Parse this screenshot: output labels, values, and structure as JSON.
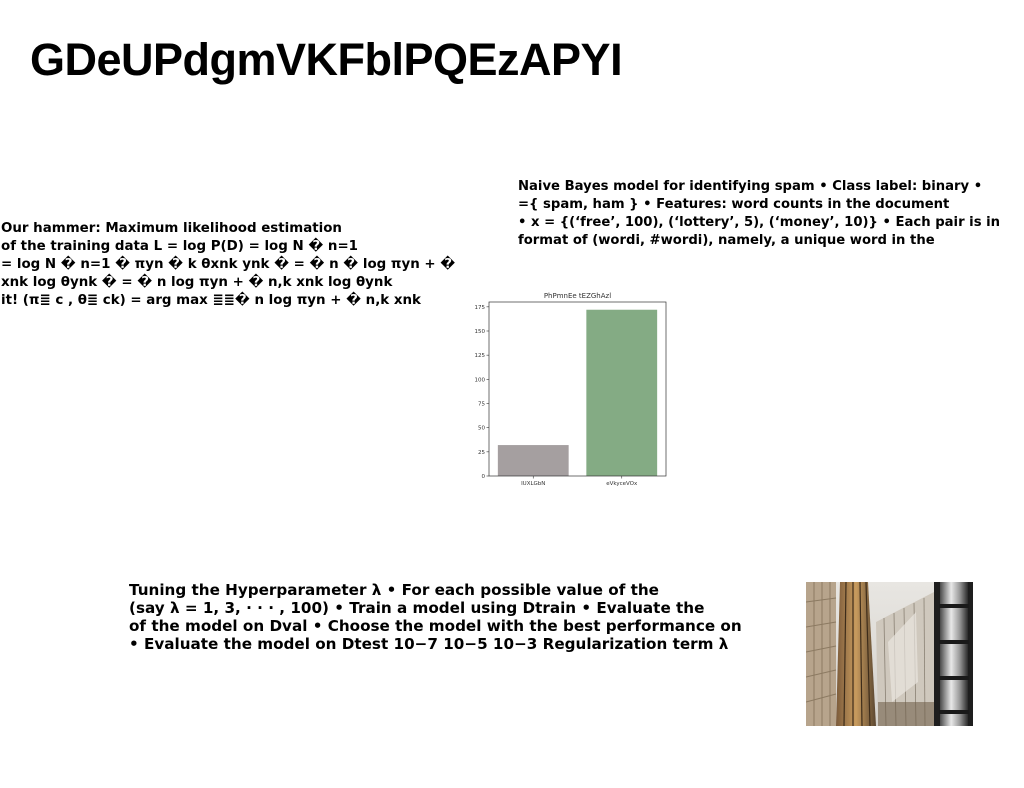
{
  "title": "GDeUPdgmVKFblPQEzAPYI",
  "spam_text": {
    "lines": [
      "Naive Bayes model for identifying spam • Class label: binary •",
      "={ spam, ham } • Features: word counts in the document",
      "• x = {(‘free’, 100), (‘lottery’, 5), (‘money’, 10)} • Each pair is in",
      "format of (wordi, #wordi), namely, a unique word in the"
    ]
  },
  "mle_text": {
    "lines": [
      "Our hammer: Maximum likelihood estimation",
      "of the training data L = log P(D) = log N � n=1",
      "= log N � n=1 � πyn � k θxnk ynk � = � n � log πyn + �",
      "xnk log θynk � = � n log πyn + � n,k xnk log θynk",
      "it! (π≣ c , θ≣ ck) = arg max ≣≣� n log πyn + � n,k xnk"
    ]
  },
  "tuning_text": {
    "lines": [
      "Tuning the Hyperparameter λ • For each possible value of the",
      "(say λ = 1, 3, · · · , 100) • Train a model using Dtrain • Evaluate the",
      "of the model on Dval • Choose the model with the best performance on",
      "• Evaluate the model on Dtest 10−7 10−5 10−3 Regularization term λ"
    ]
  },
  "chart_data": {
    "type": "bar",
    "title": "PhPmnEe tEZGhAzl",
    "categories": [
      "IUXLGbN",
      "eVkyceVOx"
    ],
    "values": [
      32,
      172
    ],
    "colors": [
      "#a59fa0",
      "#84ab84"
    ],
    "ylim": [
      0,
      180
    ],
    "yticks": [
      0,
      25,
      50,
      75,
      100,
      125,
      150,
      175
    ],
    "xlabel": "",
    "ylabel": "",
    "grid": false
  },
  "photo": {
    "icon": "building-facade-photo"
  }
}
